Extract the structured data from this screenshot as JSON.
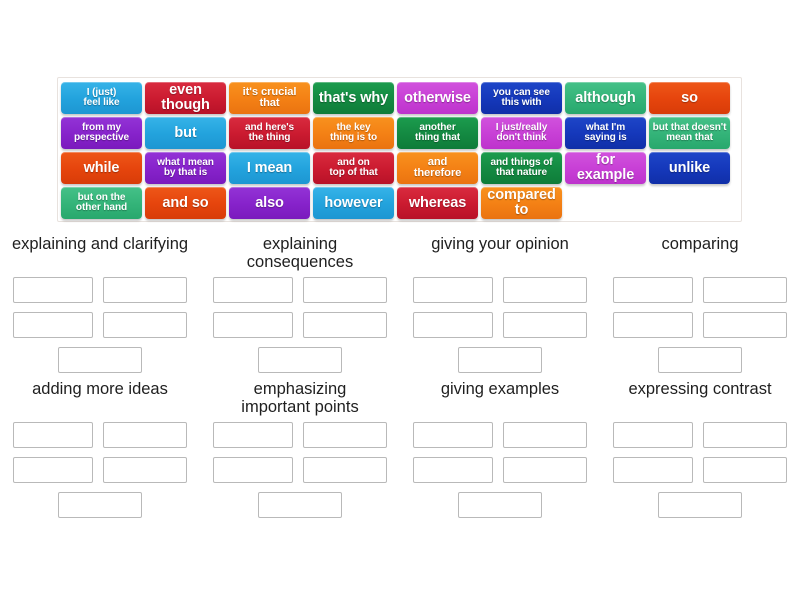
{
  "activity": {
    "type": "group-sort",
    "tile_bank": {
      "columns": 8,
      "rows": 4,
      "tiles": [
        [
          {
            "text": "I (just)\nfeel like",
            "color": "#23a3dd",
            "theme": "c-ltblue",
            "lines": 2
          },
          {
            "text": "even though",
            "color": "#cb1b30",
            "theme": "c-crimson",
            "lines": 1
          },
          {
            "text": "it's crucial\nthat",
            "color": "#f48115",
            "theme": "c-orange",
            "lines": 2
          },
          {
            "text": "that's why",
            "color": "#148a42",
            "theme": "c-dgreen",
            "lines": 1
          },
          {
            "text": "otherwise",
            "color": "#c840d6",
            "theme": "c-magenta",
            "lines": 1
          },
          {
            "text": "you can see\nthis with",
            "color": "#1538bb",
            "theme": "c-royal",
            "lines": 2
          },
          {
            "text": "although",
            "color": "#34b479",
            "theme": "c-emerald",
            "lines": 1
          },
          {
            "text": "so",
            "color": "#e6450d",
            "theme": "c-orred",
            "lines": 1
          }
        ],
        [
          {
            "text": "from my\nperspective",
            "color": "#8723cb",
            "theme": "c-purple",
            "lines": 2
          },
          {
            "text": "but",
            "color": "#23a3dd",
            "theme": "c-ltblue",
            "lines": 1
          },
          {
            "text": "and here's\nthe thing",
            "color": "#cb1b30",
            "theme": "c-crimson",
            "lines": 2
          },
          {
            "text": "the key\nthing is to",
            "color": "#f48115",
            "theme": "c-orange",
            "lines": 2
          },
          {
            "text": "another\nthing that",
            "color": "#148a42",
            "theme": "c-dgreen",
            "lines": 2
          },
          {
            "text": "I just/really\ndon't think",
            "color": "#c840d6",
            "theme": "c-magenta",
            "lines": 2
          },
          {
            "text": "what I'm\nsaying is",
            "color": "#1538bb",
            "theme": "c-royal",
            "lines": 2
          },
          {
            "text": "but that doesn't\nmean that",
            "color": "#34b479",
            "theme": "c-emerald",
            "lines": 2
          }
        ],
        [
          {
            "text": "while",
            "color": "#e6450d",
            "theme": "c-orred",
            "lines": 1
          },
          {
            "text": "what I mean\nby that is",
            "color": "#8723cb",
            "theme": "c-purple",
            "lines": 2
          },
          {
            "text": "I mean",
            "color": "#23a3dd",
            "theme": "c-ltblue",
            "lines": 1
          },
          {
            "text": "and on\ntop of that",
            "color": "#cb1b30",
            "theme": "c-crimson",
            "lines": 2
          },
          {
            "text": "and\ntherefore",
            "color": "#f48115",
            "theme": "c-orange",
            "lines": 2
          },
          {
            "text": "and things of\nthat nature",
            "color": "#148a42",
            "theme": "c-dgreen",
            "lines": 2
          },
          {
            "text": "for example",
            "color": "#c840d6",
            "theme": "c-magenta",
            "lines": 1
          },
          {
            "text": "unlike",
            "color": "#1538bb",
            "theme": "c-royal",
            "lines": 1
          }
        ],
        [
          {
            "text": "but on the\nother hand",
            "color": "#34b479",
            "theme": "c-emerald",
            "lines": 2
          },
          {
            "text": "and so",
            "color": "#e6450d",
            "theme": "c-orred",
            "lines": 1
          },
          {
            "text": "also",
            "color": "#8723cb",
            "theme": "c-purple",
            "lines": 1
          },
          {
            "text": "however",
            "color": "#23a3dd",
            "theme": "c-ltblue",
            "lines": 1
          },
          {
            "text": "whereas",
            "color": "#cb1b30",
            "theme": "c-crimson",
            "lines": 1
          },
          {
            "text": "compared to",
            "color": "#f48115",
            "theme": "c-orange",
            "lines": 1
          }
        ]
      ]
    },
    "categories": [
      {
        "title": "explaining and clarifying",
        "slot_count": 5
      },
      {
        "title": "explaining\nconsequences",
        "slot_count": 5
      },
      {
        "title": "giving your opinion",
        "slot_count": 5
      },
      {
        "title": "comparing",
        "slot_count": 5
      },
      {
        "title": "adding more ideas",
        "slot_count": 5
      },
      {
        "title": "emphasizing\nimportant points",
        "slot_count": 5
      },
      {
        "title": "giving examples",
        "slot_count": 5
      },
      {
        "title": "expressing contrast",
        "slot_count": 5
      }
    ]
  }
}
